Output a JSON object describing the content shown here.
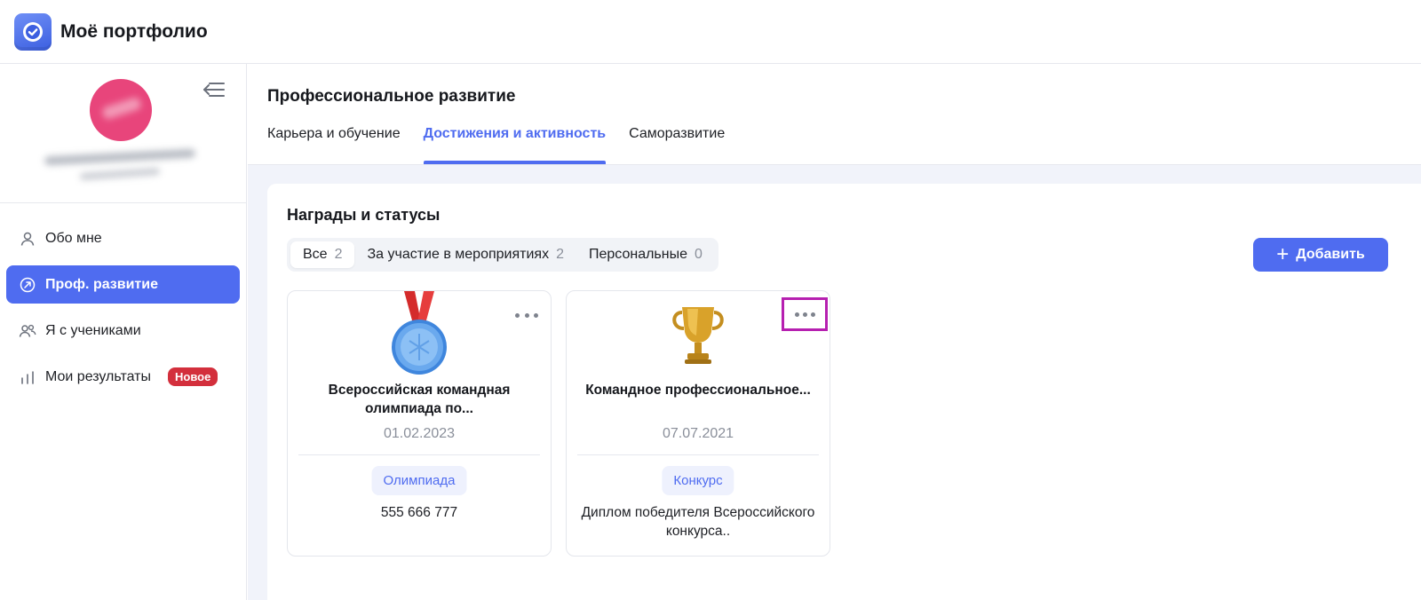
{
  "app": {
    "title": "Моё портфолио"
  },
  "sidebar": {
    "items": [
      {
        "label": "Обо мне",
        "icon": "user-icon"
      },
      {
        "label": "Проф. развитие",
        "icon": "growth-arrow-icon",
        "active": true
      },
      {
        "label": "Я с учениками",
        "icon": "users-icon"
      },
      {
        "label": "Мои результаты",
        "icon": "bar-chart-icon",
        "badge": "Новое"
      }
    ]
  },
  "main": {
    "title": "Профессиональное развитие",
    "tabs": [
      {
        "label": "Карьера и обучение"
      },
      {
        "label": "Достижения и активность",
        "active": true
      },
      {
        "label": "Саморазвитие"
      }
    ],
    "section": {
      "title": "Награды и статусы",
      "filters": [
        {
          "label": "Все",
          "count": "2",
          "active": true
        },
        {
          "label": "За участие в мероприятиях",
          "count": "2"
        },
        {
          "label": "Персональные",
          "count": "0"
        }
      ],
      "add_label": "Добавить",
      "cards": [
        {
          "icon": "medal-icon",
          "title": "Всероссийская командная олимпиада по...",
          "date": "01.02.2023",
          "tag": "Олимпиада",
          "description": "555 666 777"
        },
        {
          "icon": "trophy-icon",
          "title": "Командное профессиональное...",
          "date": "07.07.2021",
          "tag": "Конкурс",
          "description": "Диплом победителя Всероссийского конкурса.."
        }
      ]
    }
  },
  "colors": {
    "accent": "#4f6cf0",
    "badge": "#d32f3c",
    "highlight": "#b620b0",
    "avatar": "#e8457b"
  }
}
